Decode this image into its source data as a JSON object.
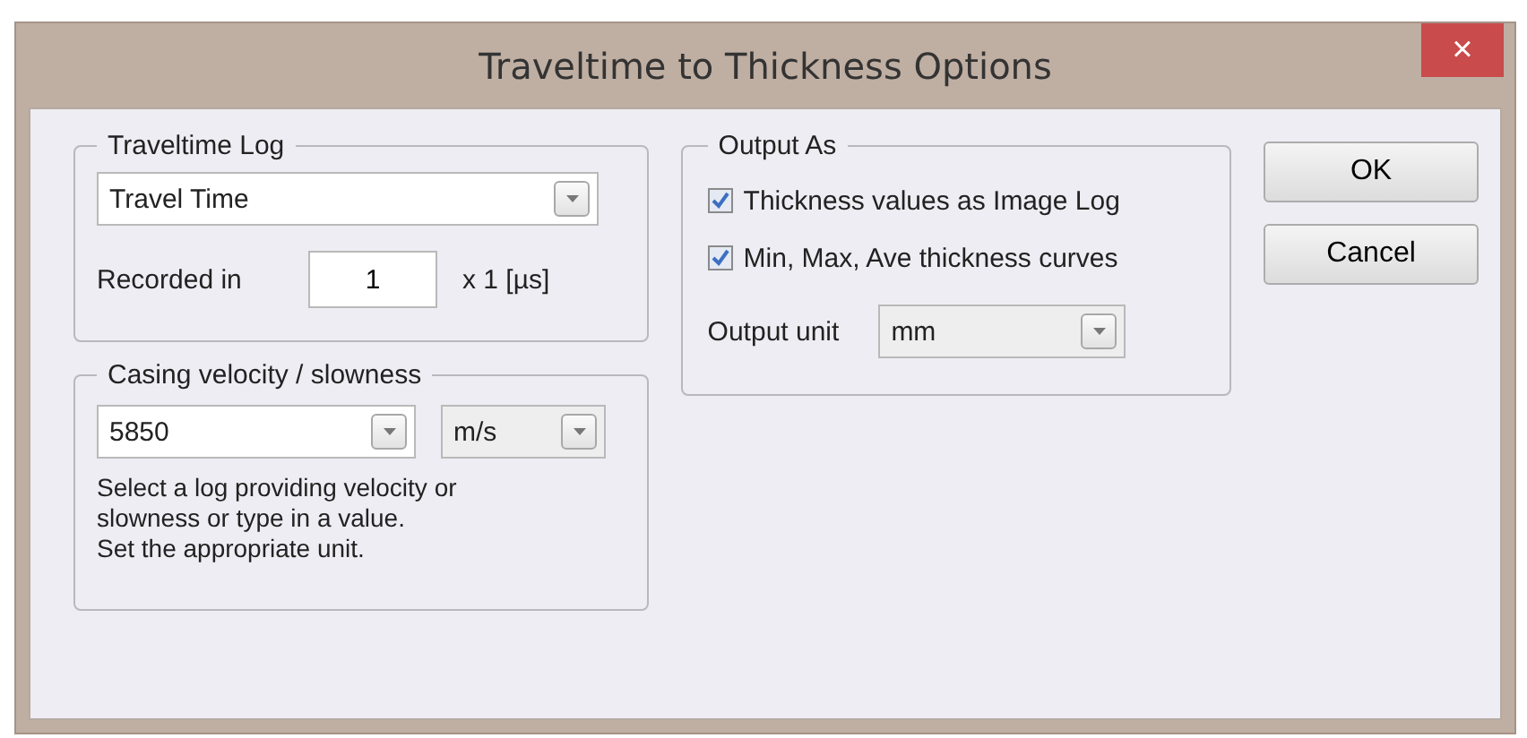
{
  "window": {
    "title": "Traveltime to Thickness Options",
    "close": "×"
  },
  "traveltime_log": {
    "legend": "Traveltime Log",
    "log": "Travel Time",
    "recorded_label": "Recorded in",
    "recorded_value": "1",
    "unit": "x 1 [µs]"
  },
  "casing": {
    "legend": "Casing velocity / slowness",
    "value": "5850",
    "unit": "m/s",
    "help": [
      "Select a log providing velocity or",
      "slowness or type in a value.",
      "Set the appropriate unit."
    ]
  },
  "output": {
    "legend": "Output As",
    "options": [
      {
        "label": "Thickness values as Image Log",
        "checked": true
      },
      {
        "label": "Min, Max, Ave thickness curves",
        "checked": true
      }
    ],
    "unit_label": "Output unit",
    "unit": "mm"
  },
  "buttons": [
    "OK",
    "Cancel"
  ]
}
